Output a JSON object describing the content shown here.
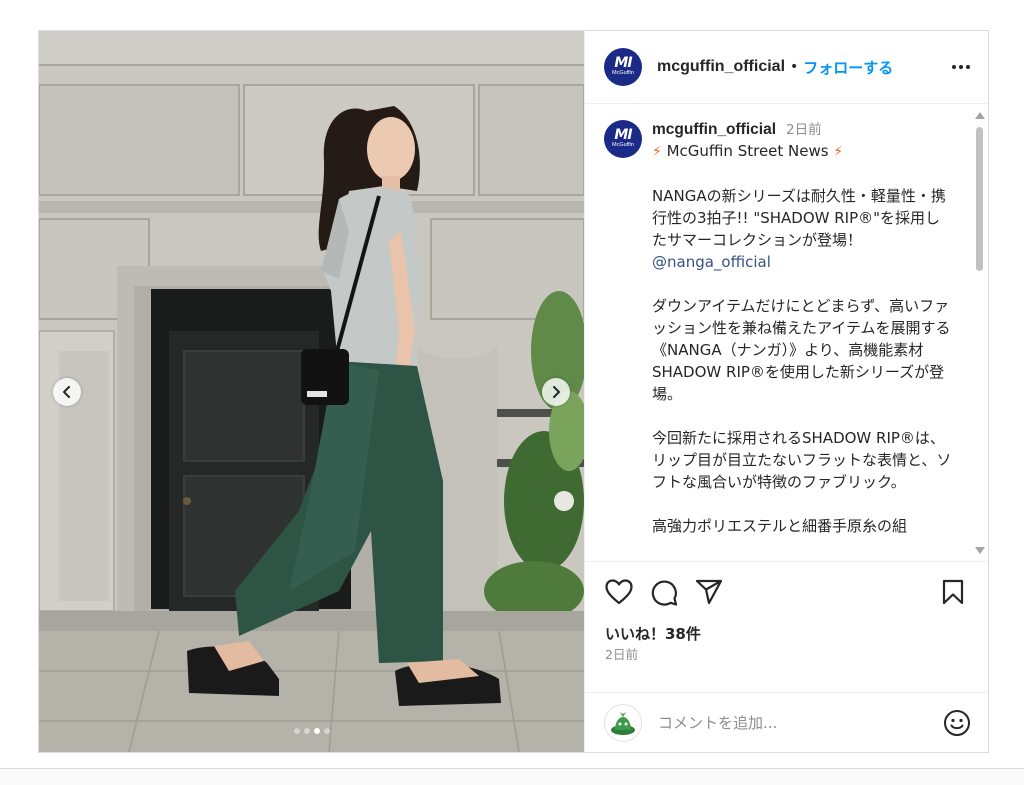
{
  "header": {
    "avatar_mark": "MI",
    "avatar_word": "McGuffin",
    "username": "mcguffin_official",
    "separator": "•",
    "follow_label": "フォローする"
  },
  "caption": {
    "username": "mcguffin_official",
    "time_ago": "2日前",
    "bolt": "⚡",
    "headline": " McGuffin Street News ",
    "paragraph_1": "NANGAの新シリーズは耐久性・軽量性・携行性の3拍子!! \"SHADOW RIP®\"を採用したサマーコレクションが登場！",
    "mention": "@nanga_official",
    "paragraph_2": "ダウンアイテムだけにとどまらず、高いファッション性を兼ね備えたアイテムを展開する《NANGA（ナンガ）》より、高機能素材SHADOW RIP®を使用した新シリーズが登場。",
    "paragraph_3": "今回新たに採用されるSHADOW RIP®は、リップ目が目立たないフラットな表情と、ソフトな風合いが特徴のファブリック。",
    "paragraph_4": "高強力ポリエステルと細番手原糸の組"
  },
  "engagement": {
    "likes_label": "いいね！38件",
    "posted_ago": "2日前"
  },
  "comment": {
    "placeholder": "コメントを追加..."
  },
  "carousel": {
    "slide_count": 4,
    "active_slide": 3
  },
  "icons": {
    "like": "heart-icon",
    "comment": "comment-bubble-icon",
    "share": "paper-plane-icon",
    "save": "bookmark-icon",
    "emoji": "smiley-icon",
    "prev": "chevron-left-icon",
    "next": "chevron-right-icon",
    "more": "more-dots-icon"
  },
  "colors": {
    "follow_blue": "#0095f6",
    "mention_blue": "#385185",
    "avatar_navy": "#1b2a86",
    "bolt_orange": "#f26a1b"
  }
}
